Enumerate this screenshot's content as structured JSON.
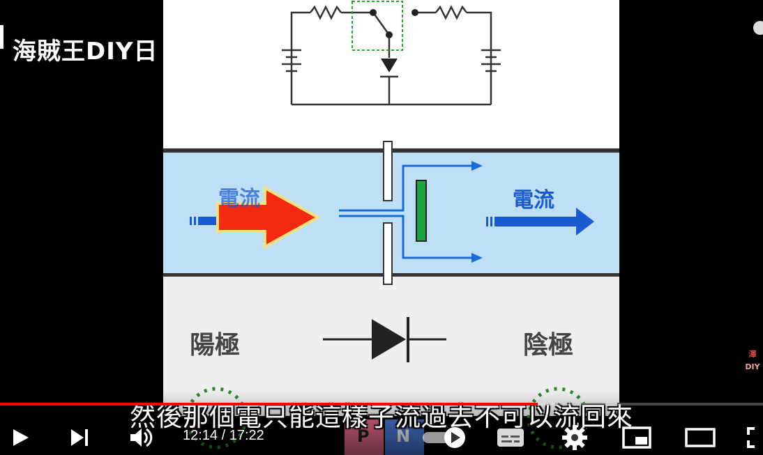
{
  "channel": {
    "title": "海賊王DIY日"
  },
  "video": {
    "slide": {
      "current_label_left": "電流",
      "current_label_right": "電流",
      "anode_label": "陽極",
      "cathode_label": "陰極",
      "p_label": "P",
      "n_label": "N"
    },
    "subtitle": "然後那個電只能這樣子流過去不可以流回來"
  },
  "player": {
    "time_current": "12:14",
    "time_separator": " / ",
    "time_total": "17:22",
    "progress_fraction": 0.705,
    "buffer_fraction": 0.73,
    "autoplay_on": true,
    "buttons": {
      "play": "play-icon",
      "next": "next-icon",
      "volume": "volume-icon",
      "autoplay": "autoplay-toggle-icon",
      "subtitles": "subtitles-icon",
      "settings": "gear-icon",
      "miniplayer": "miniplayer-icon",
      "theater": "theater-icon",
      "fullscreen": "fullscreen-icon"
    },
    "colors": {
      "progress": "#ff0000"
    }
  }
}
